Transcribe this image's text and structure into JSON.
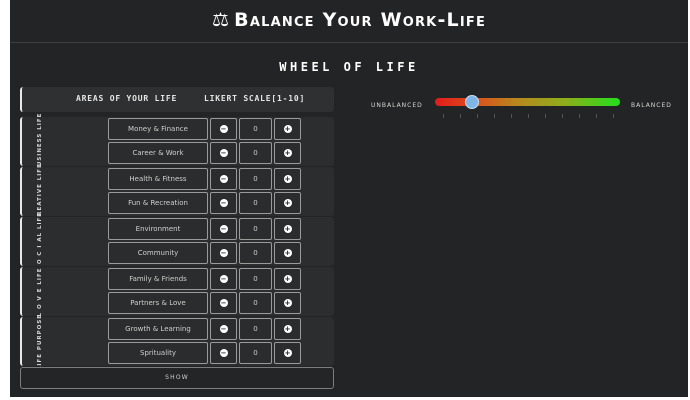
{
  "header": {
    "title": "Balance Your Work-Life",
    "subtitle": "WHEEL OF LIFE"
  },
  "table": {
    "col_areas": "AREAS OF YOUR LIFE",
    "col_scale": "LIKERT SCALE[1-10]",
    "groups": [
      {
        "label": "BUSINESS LIFE",
        "items": [
          {
            "name": "Money & Finance",
            "value": "0"
          },
          {
            "name": "Career & Work",
            "value": "0"
          }
        ]
      },
      {
        "label": "CREATIVE LIFE",
        "items": [
          {
            "name": "Health & Fitness",
            "value": "0"
          },
          {
            "name": "Fun & Recreation",
            "value": "0"
          }
        ]
      },
      {
        "label": "S O C I AL LIFE",
        "items": [
          {
            "name": "Environment",
            "value": "0"
          },
          {
            "name": "Community",
            "value": "0"
          }
        ]
      },
      {
        "label": "L O V E LIFE",
        "items": [
          {
            "name": "Family & Friends",
            "value": "0"
          },
          {
            "name": "Partners & Love",
            "value": "0"
          }
        ]
      },
      {
        "label": "LIFE PURPOSE",
        "items": [
          {
            "name": "Growth & Learning",
            "value": "0"
          },
          {
            "name": "Sprituality",
            "value": "0"
          }
        ]
      }
    ],
    "show_label": "SHOW"
  },
  "balance": {
    "left_label": "UNBALANCED",
    "right_label": "BALANCED",
    "slider_fraction": 0.2,
    "colors": {
      "start": "#e21b1b",
      "end": "#22e01c",
      "thumb": "#7fb6e6"
    }
  },
  "icons": {
    "scale": "scale-icon",
    "minus": "minus-circle-icon",
    "plus": "plus-circle-icon"
  }
}
